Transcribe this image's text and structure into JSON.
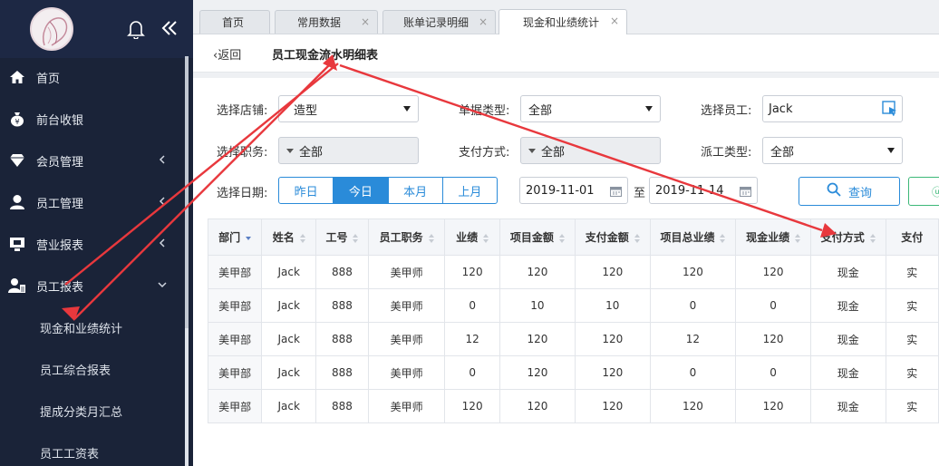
{
  "sidebar": {
    "menu": [
      {
        "label": "首页",
        "icon": "home-icon"
      },
      {
        "label": "前台收银",
        "icon": "money-bag-icon"
      },
      {
        "label": "会员管理",
        "icon": "diamond-icon"
      },
      {
        "label": "员工管理",
        "icon": "user-icon"
      },
      {
        "label": "营业报表",
        "icon": "monitor-icon"
      },
      {
        "label": "员工报表",
        "icon": "user-report-icon"
      }
    ],
    "submenu": [
      "现金和业绩统计",
      "员工综合报表",
      "提成分类月汇总",
      "员工工资表"
    ]
  },
  "tabs": [
    {
      "label": "首页"
    },
    {
      "label": "常用数据"
    },
    {
      "label": "账单记录明细"
    },
    {
      "label": "现金和业绩统计"
    }
  ],
  "header": {
    "back_label": "返回",
    "title": "员工现金流水明细表"
  },
  "filters": {
    "store_label": "选择店铺:",
    "store_value": "造型",
    "bill_type_label": "单据类型:",
    "bill_type_value": "全部",
    "employee_label": "选择员工:",
    "employee_value": "Jack",
    "position_label": "选择职务:",
    "position_value": "全部",
    "payment_label": "支付方式:",
    "payment_value": "全部",
    "dispatch_label": "派工类型:",
    "dispatch_value": "全部",
    "date_label": "选择日期:",
    "quick_dates": [
      "昨日",
      "今日",
      "本月",
      "上月"
    ],
    "quick_dates_selected": "今日",
    "date_from": "2019-11-01",
    "date_sep": "至",
    "date_to": "2019-11-14",
    "query_button": "查询"
  },
  "table": {
    "headers": [
      "部门",
      "姓名",
      "工号",
      "员工职务",
      "业绩",
      "项目金额",
      "支付金额",
      "项目总业绩",
      "现金业绩",
      "支付方式",
      "支付"
    ],
    "rows": [
      [
        "美甲部",
        "Jack",
        "888",
        "美甲师",
        "120",
        "120",
        "120",
        "120",
        "120",
        "现金",
        "实"
      ],
      [
        "美甲部",
        "Jack",
        "888",
        "美甲师",
        "0",
        "10",
        "10",
        "0",
        "0",
        "现金",
        "实"
      ],
      [
        "美甲部",
        "Jack",
        "888",
        "美甲师",
        "12",
        "120",
        "120",
        "12",
        "120",
        "现金",
        "实"
      ],
      [
        "美甲部",
        "Jack",
        "888",
        "美甲师",
        "0",
        "120",
        "120",
        "0",
        "0",
        "现金",
        "实"
      ],
      [
        "美甲部",
        "Jack",
        "888",
        "美甲师",
        "120",
        "120",
        "120",
        "120",
        "120",
        "现金",
        "实"
      ]
    ]
  },
  "colors": {
    "sidebar_bg": "#1a2338",
    "accent": "#2a8bd9",
    "annotation_red": "#e8383d"
  }
}
